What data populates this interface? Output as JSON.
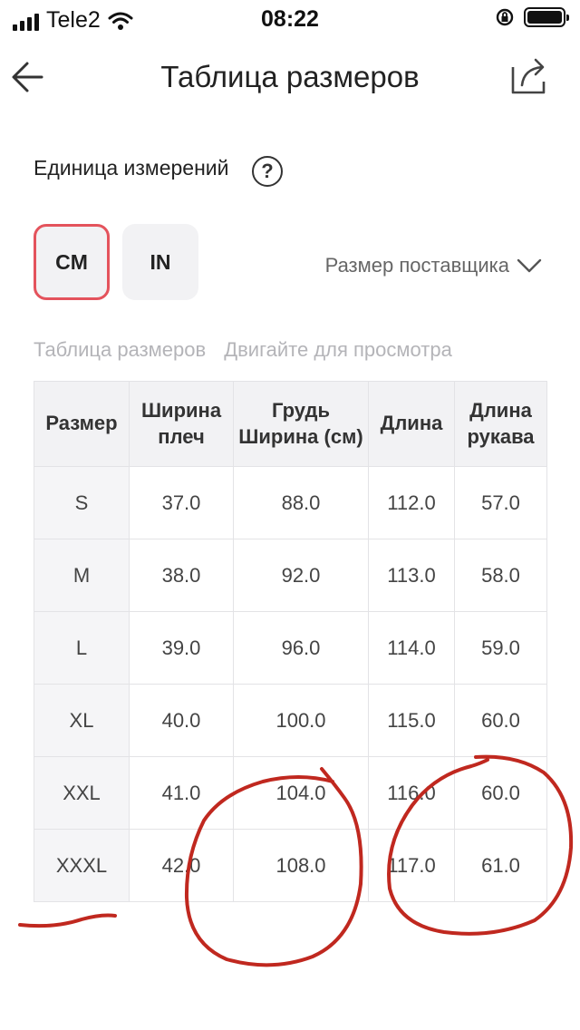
{
  "status_bar": {
    "carrier": "Tele2",
    "time": "08:22"
  },
  "header": {
    "title": "Таблица размеров",
    "back_icon": "arrow-left-icon",
    "share_icon": "share-icon"
  },
  "units": {
    "label": "Единица измерений",
    "help_symbol": "?",
    "options": [
      {
        "label": "CM",
        "selected": true
      },
      {
        "label": "IN",
        "selected": false
      }
    ],
    "supplier_size": "Размер поставщика"
  },
  "hints": {
    "table_label": "Таблица размеров",
    "scroll_hint": "Двигайте для просмотра"
  },
  "table": {
    "headers": [
      "Размер",
      "Ширина плеч",
      "Грудь Ширина (см)",
      "Длина",
      "Длина рукава"
    ],
    "rows": [
      [
        "S",
        "37.0",
        "88.0",
        "112.0",
        "57.0"
      ],
      [
        "M",
        "38.0",
        "92.0",
        "113.0",
        "58.0"
      ],
      [
        "L",
        "39.0",
        "96.0",
        "114.0",
        "59.0"
      ],
      [
        "XL",
        "40.0",
        "100.0",
        "115.0",
        "60.0"
      ],
      [
        "XXL",
        "41.0",
        "104.0",
        "116.0",
        "60.0"
      ],
      [
        "XXXL",
        "42.0",
        "108.0",
        "117.0",
        "61.0"
      ]
    ]
  },
  "colors": {
    "accent": "#e4535c",
    "annotation_ink": "#c0281f"
  }
}
